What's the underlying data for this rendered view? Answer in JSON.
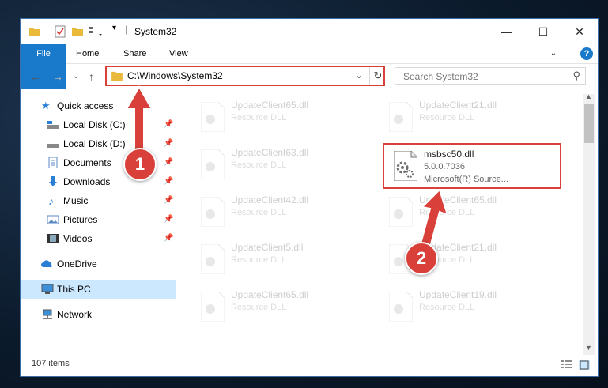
{
  "window": {
    "title": "System32"
  },
  "ribbon": {
    "file": "File",
    "home": "Home",
    "share": "Share",
    "view": "View",
    "help": "?"
  },
  "address": {
    "path": "C:\\Windows\\System32"
  },
  "search": {
    "placeholder": "Search System32"
  },
  "nav": {
    "quick_access": "Quick access",
    "items": [
      {
        "label": "Local Disk (C:)"
      },
      {
        "label": "Local Disk (D:)"
      },
      {
        "label": "Documents"
      },
      {
        "label": "Downloads"
      },
      {
        "label": "Music"
      },
      {
        "label": "Pictures"
      },
      {
        "label": "Videos"
      }
    ],
    "onedrive": "OneDrive",
    "this_pc": "This PC",
    "network": "Network"
  },
  "files": {
    "ghost": [
      {
        "name": "UpdateClient65.dll",
        "type": "Resource DLL"
      },
      {
        "name": "UpdateClient21.dll",
        "type": "Resource DLL"
      },
      {
        "name": "UpdateClient63.dll",
        "type": "Resource DLL"
      },
      {
        "name": "UpdateClient42.dll",
        "type": "Resource DLL"
      },
      {
        "name": "UpdateClient65.dll",
        "type": "Resource DLL"
      },
      {
        "name": "UpdateClient5.dll",
        "type": "Resource DLL"
      },
      {
        "name": "UpdateClient21.dll",
        "type": "Resource DLL"
      },
      {
        "name": "UpdateClient65.dll",
        "type": "Resource DLL"
      },
      {
        "name": "UpdateClient19.dll",
        "type": "Resource DLL"
      }
    ],
    "target": {
      "name": "msbsc50.dll",
      "version": "5.0.0.7036",
      "company": "Microsoft(R) Source..."
    }
  },
  "status": {
    "count": "107 items"
  },
  "annotations": {
    "step1": "1",
    "step2": "2"
  },
  "colors": {
    "accent": "#1979ca",
    "annotation": "#d9403a"
  }
}
